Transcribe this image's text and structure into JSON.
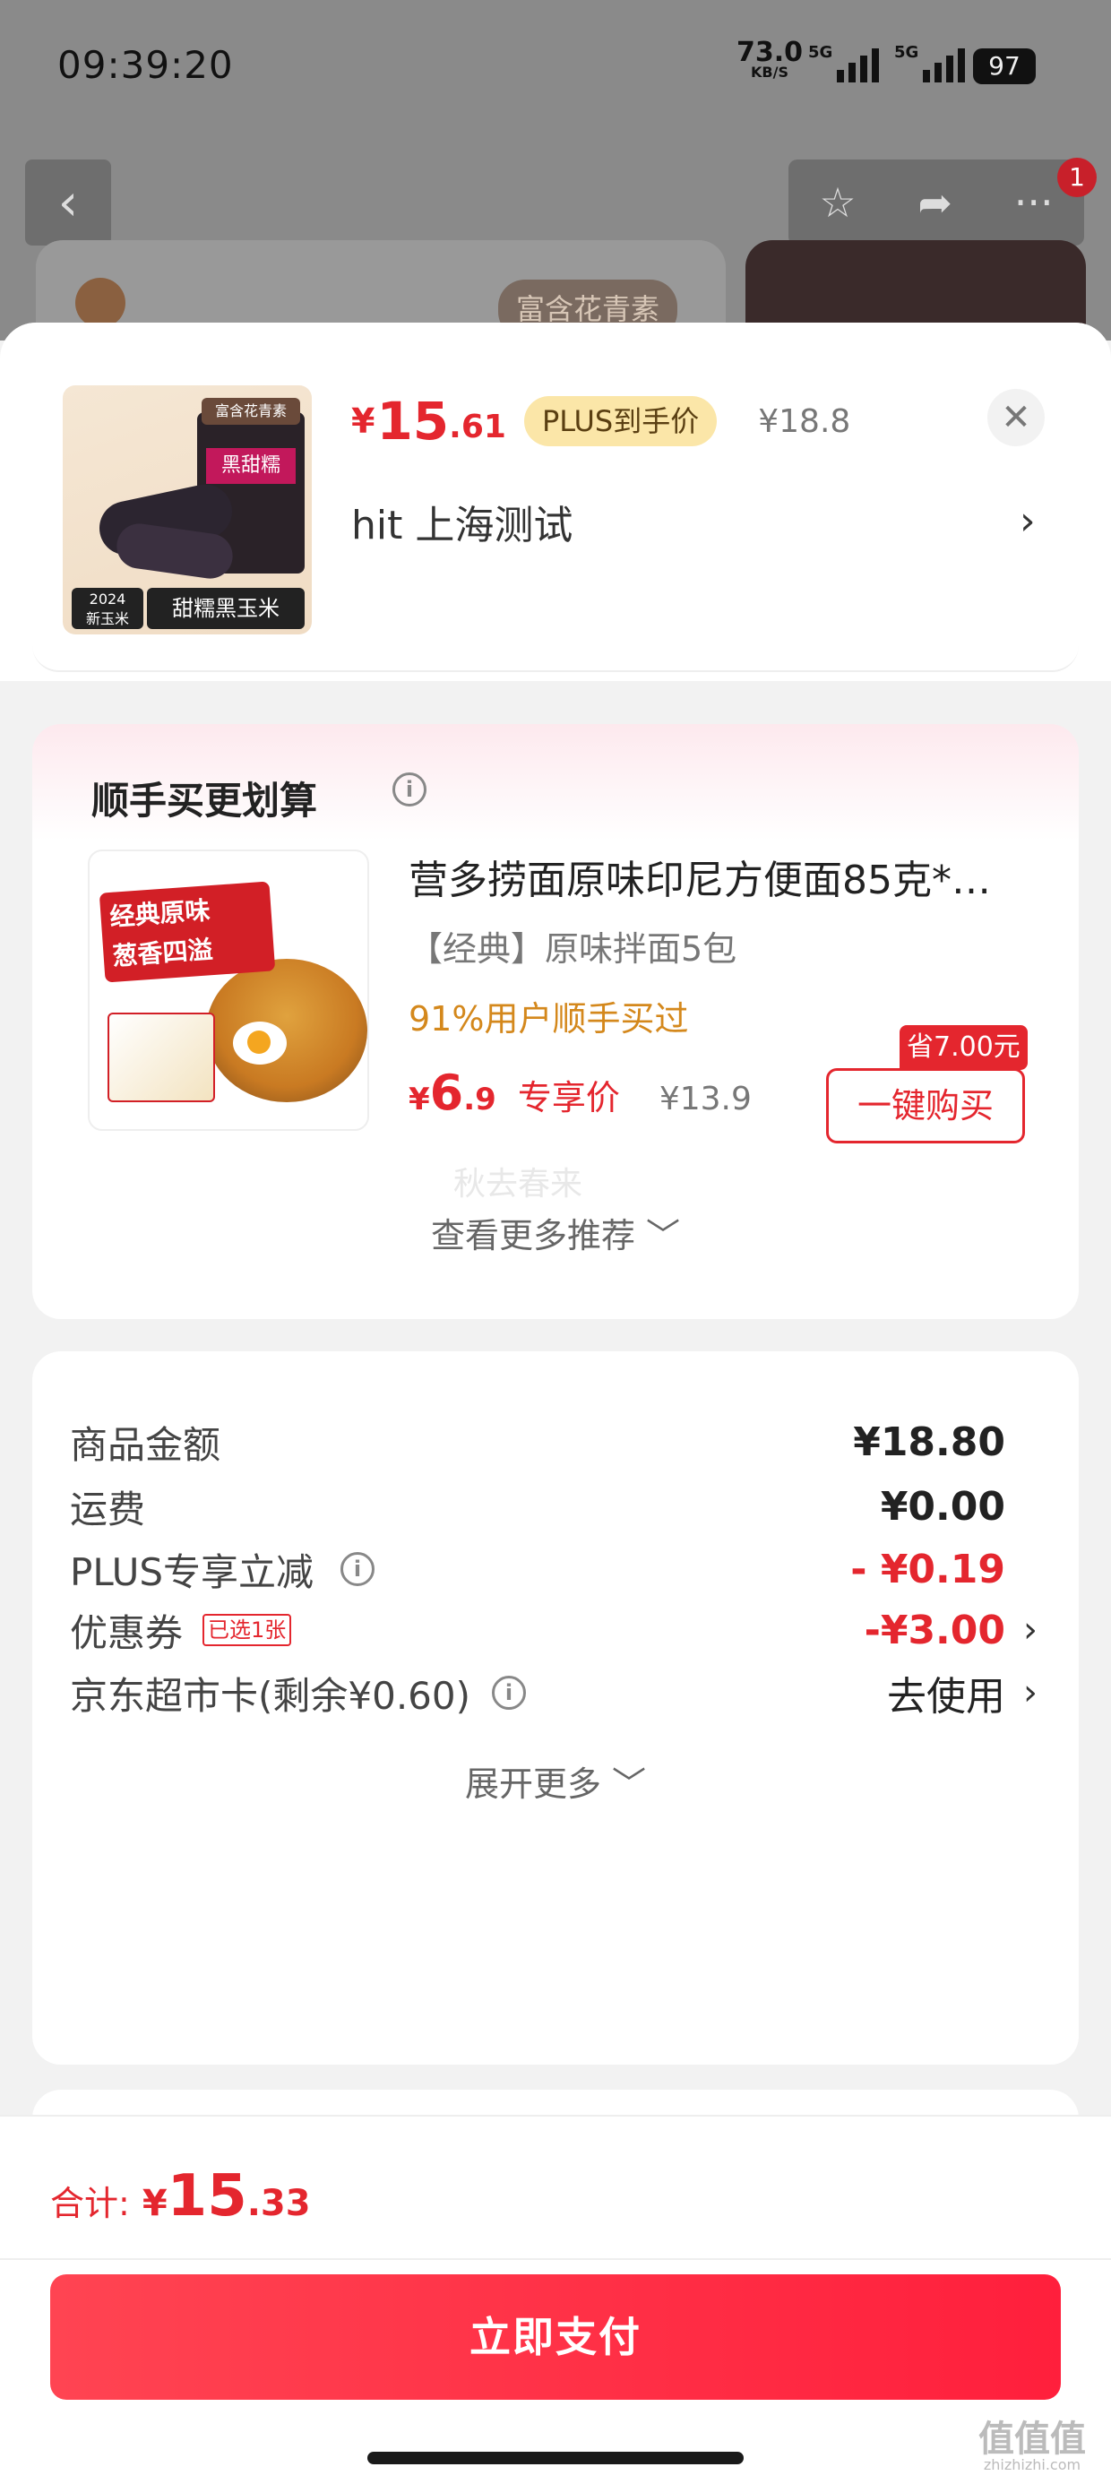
{
  "status_bar": {
    "time": "09:39:20",
    "net_speed": "73.0",
    "net_unit": "KB/S",
    "sim1": "5G",
    "sim2": "5G",
    "battery": "97"
  },
  "background": {
    "badge_count": "1",
    "product_tag": "富含花青素"
  },
  "sheet": {
    "close_icon": "close-icon",
    "product": {
      "thumb_tag": "富含花青素",
      "thumb_brand": "黑甜糯",
      "thumb_year": "2024",
      "thumb_new": "新玉米",
      "thumb_name": "甜糯黑玉米",
      "price_symbol": "¥",
      "price_int": "15",
      "price_dec": ".61",
      "plus_label": "PLUS到手价",
      "original_price": "¥18.8"
    },
    "address": "hit  上海测试",
    "address_arrow": "›"
  },
  "recommend": {
    "title": "顺手买更划算",
    "item": {
      "thumb_banner": "经典原味\n葱香四溢",
      "name": "营多捞面原味印尼方便面85克*…",
      "spec": "【经典】原味拌面5包",
      "stat": "91%用户顺手买过",
      "price_symbol": "¥",
      "price_int": "6",
      "price_dec": ".9",
      "price_label": "专享价",
      "original_price": "¥13.9",
      "save_tag": "省7.00元",
      "buy_label": "一键购买"
    },
    "watermark": "秋去春来",
    "more_label": "查看更多推荐 ﹀"
  },
  "summary": {
    "rows": [
      {
        "label": "商品金额",
        "value": "¥18.80"
      },
      {
        "label": "运费",
        "value": "¥0.00"
      },
      {
        "label": "PLUS专享立减",
        "value": "- ¥0.19"
      },
      {
        "label": "优惠券",
        "badge": "已选1张",
        "value": "-¥3.00"
      },
      {
        "label": "京东超市卡(剩余¥0.60)",
        "value": "去使用"
      }
    ],
    "more_label": "展开更多 ﹀",
    "accent": "#e4262e"
  },
  "footer": {
    "total_label": "合计:",
    "total_symbol": "¥",
    "total_int": "15",
    "total_dec": ".33",
    "pay_label": "立即支付",
    "watermark": "值值值",
    "watermark_site": "zhizhizhi.com"
  }
}
